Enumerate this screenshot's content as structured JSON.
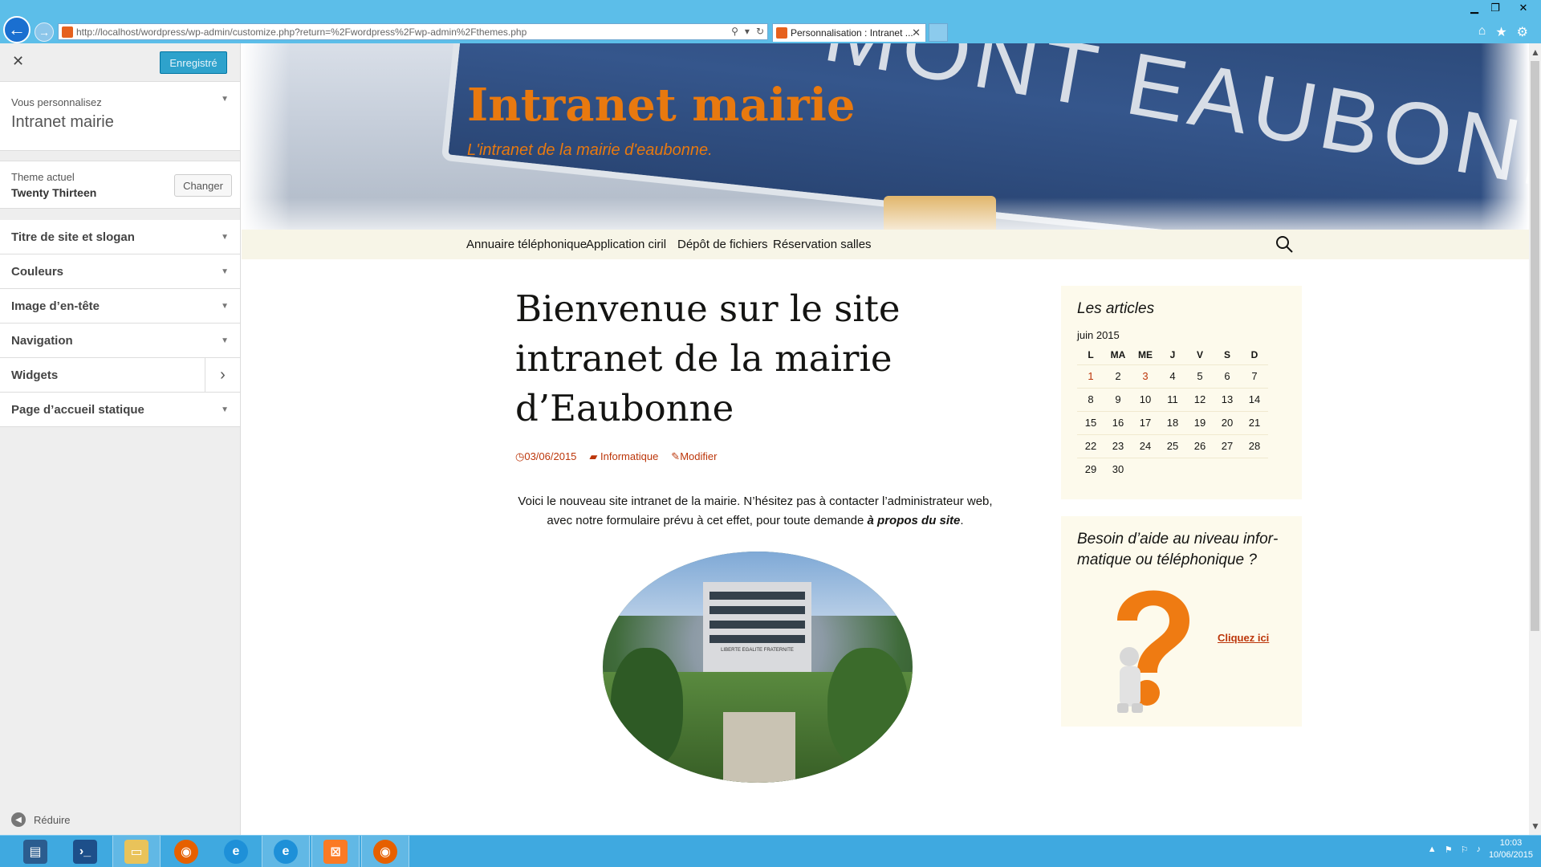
{
  "browser": {
    "url": "http://localhost/wordpress/wp-admin/customize.php?return=%2Fwordpress%2Fwp-admin%2Fthemes.php",
    "tab_title": "Personnalisation : Intranet ...",
    "window_controls": [
      "minimize-icon",
      "restore-icon",
      "close-icon"
    ],
    "toolbar_icons": [
      "home-icon",
      "star-icon",
      "gear-icon"
    ]
  },
  "customizer": {
    "close_label": "✕",
    "save_button": "Enregistré",
    "info_small": "Vous personnalisez",
    "info_title": "Intranet mairie",
    "theme_small": "Theme actuel",
    "theme_name": "Twenty Thirteen",
    "change_button": "Changer",
    "sections": [
      {
        "label": "Titre de site et slogan"
      },
      {
        "label": "Couleurs"
      },
      {
        "label": "Image d’en-tête"
      },
      {
        "label": "Navigation"
      },
      {
        "label": "Widgets"
      },
      {
        "label": "Page d’accueil statique"
      }
    ],
    "collapse_label": "Réduire"
  },
  "site": {
    "title": "Intranet mairie",
    "description": "L'intranet de la mairie d'eaubonne.",
    "header_image_text": "MONT EAUBONNE",
    "menu": [
      "Annuaire téléphonique",
      "Application ciril",
      "Dépôt de fichiers",
      "Réservation salles"
    ],
    "post": {
      "title": "Bienvenue sur le site intranet de la mairie d’Eaubonne",
      "date": "03/06/2015",
      "category": "Informatique",
      "edit": "Modifier",
      "body_text": "Voici le nouveau site intranet de la mairie. N’hésitez pas à contacter l’administrateur web, avec notre formulaire prévu à cet effet, pour toute demande ",
      "body_emph": "à propos du site",
      "body_end": ".",
      "image_text": "LIBERTE EGALITE FRATERNITE"
    },
    "widgets": {
      "calendar_title": "Les articles",
      "calendar_caption": "juin 2015",
      "weekdays": [
        "L",
        "MA",
        "ME",
        "J",
        "V",
        "S",
        "D"
      ],
      "weeks": [
        [
          "1",
          "2",
          "3",
          "4",
          "5",
          "6",
          "7"
        ],
        [
          "8",
          "9",
          "10",
          "11",
          "12",
          "13",
          "14"
        ],
        [
          "15",
          "16",
          "17",
          "18",
          "19",
          "20",
          "21"
        ],
        [
          "22",
          "23",
          "24",
          "25",
          "26",
          "27",
          "28"
        ],
        [
          "29",
          "30",
          "",
          "",
          "",
          "",
          ""
        ]
      ],
      "linked_days": [
        "1",
        "3"
      ],
      "help_title": "Besoin d’aide au niveau infor­matique ou téléphonique ?",
      "help_link": "Cliquez ici"
    }
  },
  "taskbar": {
    "apps": [
      "server-manager-icon",
      "powershell-icon",
      "file-explorer-icon",
      "firefox-icon",
      "internet-explorer-icon",
      "internet-explorer-icon",
      "xampp-icon",
      "firefox-icon"
    ],
    "time": "10:03",
    "date": "10/06/2015"
  },
  "colors": {
    "accent_orange": "#e8790f",
    "link_red": "#bc360a",
    "save_blue": "#2ea2cc",
    "nav_bg": "#f7f5e7",
    "widget_bg": "#fdfaec",
    "chrome_blue": "#5cbee9"
  }
}
